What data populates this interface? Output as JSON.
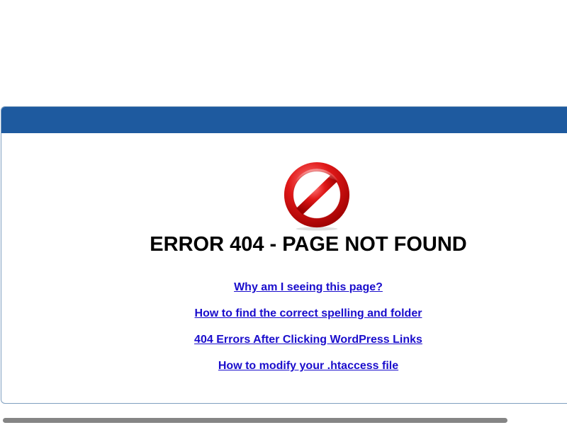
{
  "error": {
    "title": "ERROR 404 - PAGE NOT FOUND",
    "icon": "no-entry-icon"
  },
  "links": [
    {
      "label": "Why am I seeing this page?"
    },
    {
      "label": "How to find the correct spelling and folder"
    },
    {
      "label": "404 Errors After Clicking WordPress Links"
    },
    {
      "label": "How to modify your .htaccess file"
    }
  ],
  "colors": {
    "header": "#1e5a9f",
    "link": "#1a0dcc",
    "icon_red": "#d11010"
  }
}
